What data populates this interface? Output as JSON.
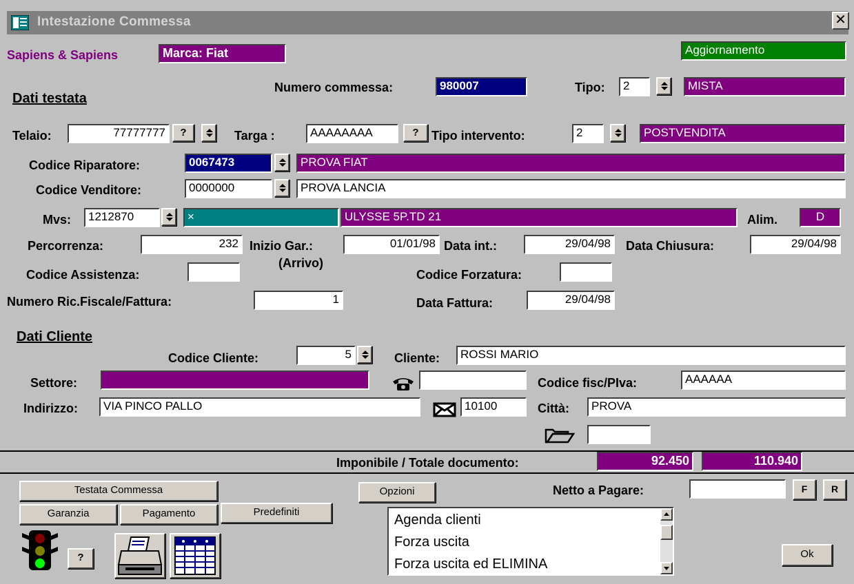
{
  "window": {
    "title": "Intestazione Commessa",
    "close_glyph": "✕"
  },
  "header": {
    "company": "Sapiens & Sapiens",
    "brand": "Marca: Fiat",
    "mode": "Aggiornamento"
  },
  "testata": {
    "section_title": "Dati  testata",
    "numero_label": "Numero commessa:",
    "numero_value": "980007",
    "tipo_label": "Tipo:",
    "tipo_code": "2",
    "tipo_desc": "MISTA",
    "telaio_label": "Telaio:",
    "telaio_value": "77777777",
    "targa_label": "Targa :",
    "targa_value": "AAAAAAAA",
    "tipo_interv_label": "Tipo intervento:",
    "tipo_interv_code": "2",
    "tipo_interv_desc": "POSTVENDITA",
    "riparatore_label": "Codice Riparatore:",
    "riparatore_code": "0067473",
    "riparatore_desc": "PROVA FIAT",
    "venditore_label": "Codice Venditore:",
    "venditore_code": "0000000",
    "venditore_desc": "PROVA LANCIA",
    "mvs_label": "Mvs:",
    "mvs_code": "1212870",
    "mvs_mark": "×",
    "mvs_desc": "ULYSSE 5P.TD 21",
    "alim_label": "Alim.",
    "alim_value": "D",
    "percorrenza_label": "Percorrenza:",
    "percorrenza_value": "232",
    "inizio_gar_label": "Inizio Gar.:",
    "inizio_gar_value": "01/01/98",
    "arrivo_label": "(Arrivo)",
    "data_int_label": "Data int.:",
    "data_int_value": "29/04/98",
    "data_chiusura_label": "Data Chiusura:",
    "data_chiusura_value": "29/04/98",
    "assistenza_label": "Codice Assistenza:",
    "assistenza_value": "",
    "forzatura_label": "Codice Forzatura:",
    "forzatura_value": "",
    "ricevuta_label": "Numero Ric.Fiscale/Fattura:",
    "ricevuta_value": "1",
    "data_fattura_label": "Data Fattura:",
    "data_fattura_value": "29/04/98",
    "question_mark": "?"
  },
  "cliente": {
    "section_title": "Dati  Cliente",
    "codice_label": "Codice Cliente:",
    "codice_value": "5",
    "cliente_label": "Cliente:",
    "cliente_value": "ROSSI MARIO",
    "settore_label": "Settore:",
    "settore_value": "",
    "telefono_value": "",
    "cf_label": "Codice fisc/PIva:",
    "cf_value": "AAAAAA",
    "indirizzo_label": "Indirizzo:",
    "indirizzo_value": "VIA PINCO PALLO",
    "cap_value": "10100",
    "citta_label": "Città:",
    "citta_value": "PROVA",
    "cartella_value": ""
  },
  "totals": {
    "label": "Imponibile / Totale documento:",
    "imponibile": "92.450",
    "totale": "110.940"
  },
  "footer": {
    "testata_btn": "Testata Commessa",
    "garanzia_btn": "Garanzia",
    "pagamento_btn": "Pagamento",
    "predefiniti_btn": "Predefiniti",
    "opzioni_btn": "Opzioni",
    "netto_label": "Netto a Pagare:",
    "netto_value": "",
    "f_btn": "F",
    "r_btn": "R",
    "ok_btn": "Ok",
    "help_btn": "?",
    "options": [
      "Agenda clienti",
      "Forza uscita",
      "Forza uscita ed ELIMINA"
    ]
  },
  "colors": {
    "purple": "#800080",
    "navy": "#000080",
    "teal": "#008080",
    "green": "#008000",
    "face": "#c0c0c0"
  },
  "icons": [
    "app-icon",
    "close-icon",
    "telephone-icon",
    "envelope-icon",
    "folder-icon",
    "traffic-light-icon",
    "printer-icon",
    "calendar-grid-icon"
  ]
}
